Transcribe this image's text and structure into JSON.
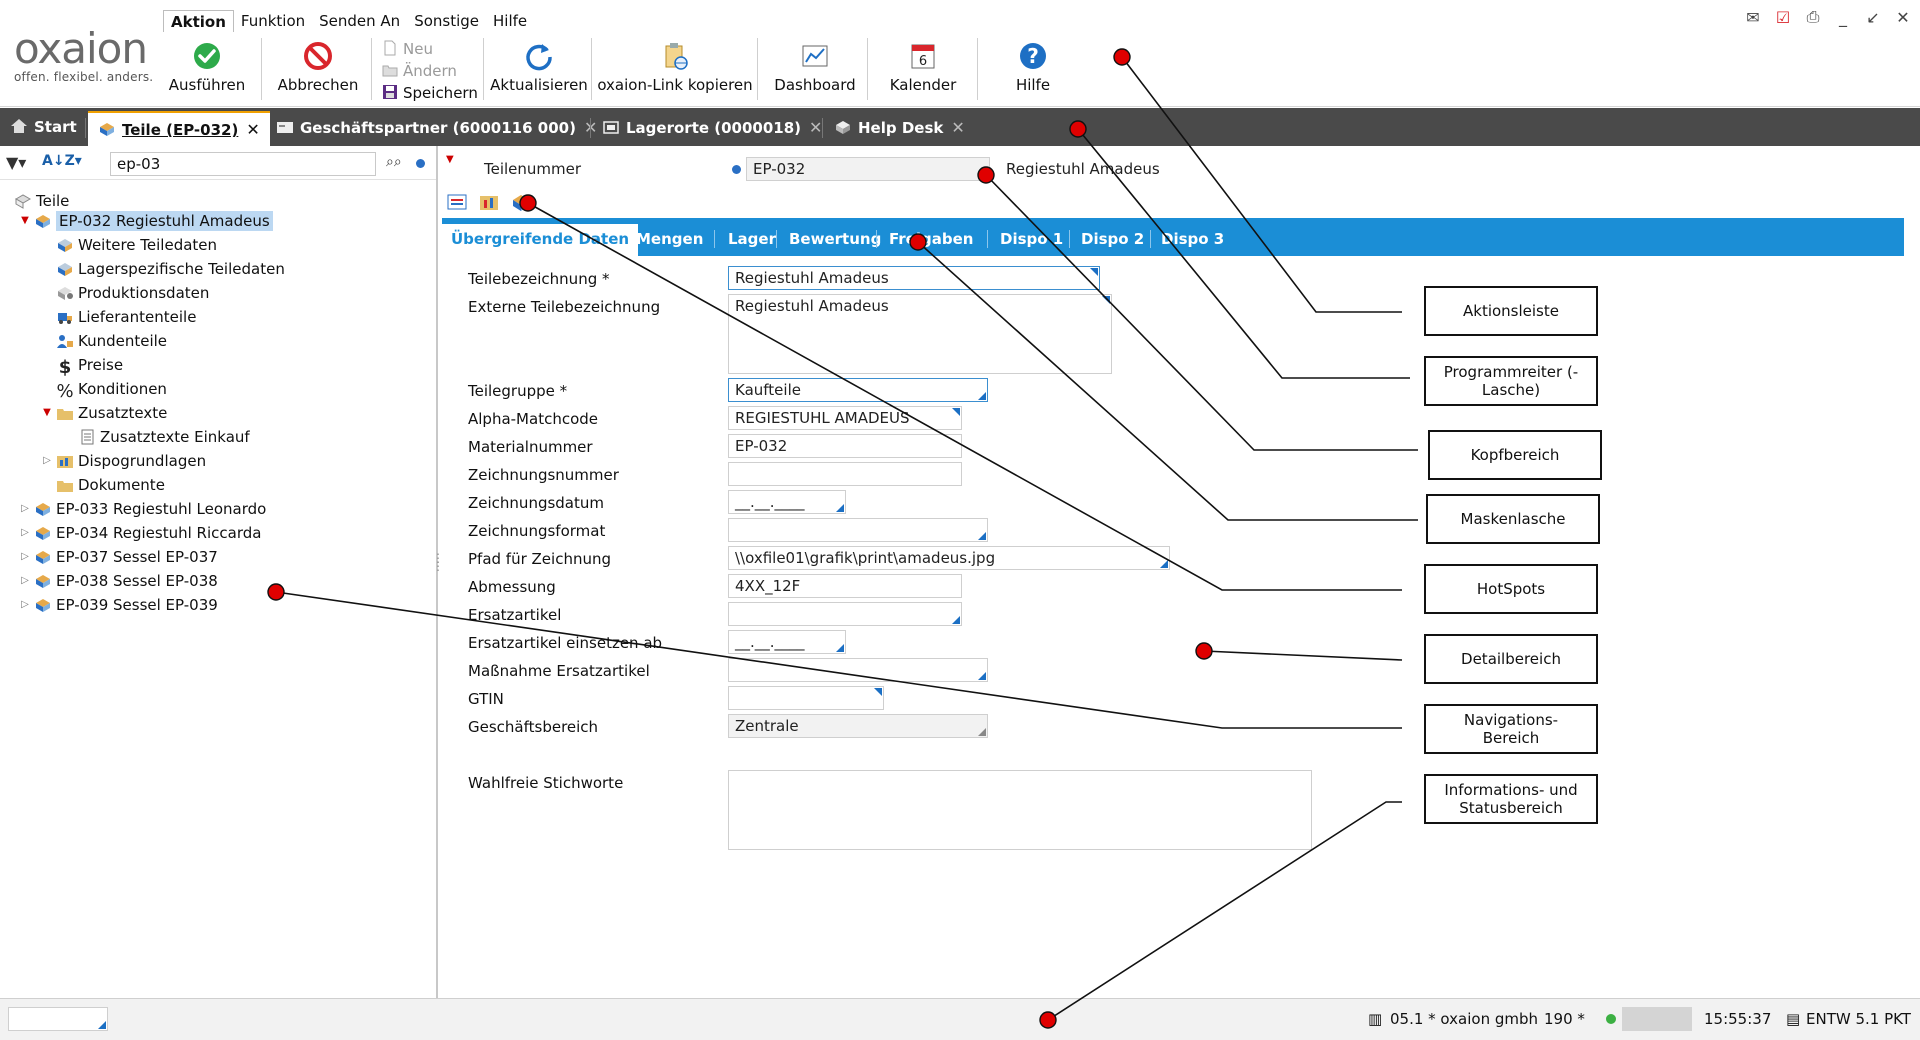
{
  "logo": {
    "brand": "oxaion",
    "claim": "offen. flexibel. anders."
  },
  "menubar": [
    "Aktion",
    "Funktion",
    "Senden An",
    "Sonstige",
    "Hilfe"
  ],
  "toolbar": {
    "execute": "Ausführen",
    "cancel": "Abbrechen",
    "new": "Neu",
    "edit": "Ändern",
    "save": "Speichern",
    "refresh": "Aktualisieren",
    "copy_link": "oxaion-Link kopieren",
    "dashboard": "Dashboard",
    "calendar": "Kalender",
    "calendar_day": "6",
    "help": "Hilfe"
  },
  "tabs": [
    {
      "label": "Start"
    },
    {
      "label": "Teile (EP-032)"
    },
    {
      "label": "Geschäftspartner (6000116 000)"
    },
    {
      "label": "Lagerorte (0000018)"
    },
    {
      "label": "Help Desk"
    }
  ],
  "nav": {
    "search_value": "ep-03",
    "tree": [
      {
        "label": "Teile"
      },
      {
        "label": "EP-032 Regiestuhl Amadeus"
      },
      {
        "label": "Weitere Teiledaten"
      },
      {
        "label": "Lagerspezifische Teiledaten"
      },
      {
        "label": "Produktionsdaten"
      },
      {
        "label": "Lieferantenteile"
      },
      {
        "label": "Kundenteile"
      },
      {
        "label": "Preise"
      },
      {
        "label": "Konditionen"
      },
      {
        "label": "Zusatztexte"
      },
      {
        "label": "Zusatztexte Einkauf"
      },
      {
        "label": "Dispogrundlagen"
      },
      {
        "label": "Dokumente"
      },
      {
        "label": "EP-033 Regiestuhl Leonardo"
      },
      {
        "label": "EP-034 Regiestuhl Riccarda"
      },
      {
        "label": "EP-037 Sessel EP-037"
      },
      {
        "label": "EP-038 Sessel EP-038"
      },
      {
        "label": "EP-039 Sessel EP-039"
      }
    ]
  },
  "head": {
    "label": "Teilenummer",
    "value": "EP-032",
    "description": "Regiestuhl Amadeus"
  },
  "mask_tabs": [
    "Übergreifende Daten",
    "Mengen",
    "Lager",
    "Bewertung",
    "Freigaben",
    "Dispo 1",
    "Dispo 2",
    "Dispo 3"
  ],
  "fields": [
    {
      "label": "Teilebezeichnung *",
      "value": "Regiestuhl Amadeus"
    },
    {
      "label": "Externe Teilebezeichnung",
      "value": "Regiestuhl Amadeus"
    },
    {
      "label": "Teilegruppe *",
      "value": "Kaufteile"
    },
    {
      "label": "Alpha-Matchcode",
      "value": "REGIESTUHL AMADEUS"
    },
    {
      "label": "Materialnummer",
      "value": "EP-032"
    },
    {
      "label": "Zeichnungsnummer",
      "value": ""
    },
    {
      "label": "Zeichnungsdatum",
      "value": "__.__.____"
    },
    {
      "label": "Zeichnungsformat",
      "value": ""
    },
    {
      "label": "Pfad für Zeichnung",
      "value": "\\\\oxfile01\\grafik\\print\\amadeus.jpg"
    },
    {
      "label": "Abmessung",
      "value": "4XX_12F"
    },
    {
      "label": "Ersatzartikel",
      "value": ""
    },
    {
      "label": "Ersatzartikel einsetzen ab",
      "value": "__.__.____"
    },
    {
      "label": "Maßnahme Ersatzartikel",
      "value": ""
    },
    {
      "label": "GTIN",
      "value": ""
    },
    {
      "label": "Geschäftsbereich",
      "value": "Zentrale"
    },
    {
      "label": "Wahlfreie Stichworte",
      "value": ""
    }
  ],
  "status": {
    "company": "05.1 * oxaion gmbh",
    "count": "190 *",
    "time": "15:55:37",
    "env": "ENTW 5.1 PKT"
  },
  "callouts": [
    "Aktionsleiste",
    "Programmreiter (-Lasche)",
    "Kopfbereich",
    "Maskenlasche",
    "HotSpots",
    "Detailbereich",
    "Navigations- Bereich",
    "Informations- und Statusbereich"
  ],
  "colors": {
    "tabbar": "#4a4a4a",
    "mask_tabs": "#1b8ed6",
    "marker": "#e00000",
    "active_tab_accent": "#f0a000"
  }
}
